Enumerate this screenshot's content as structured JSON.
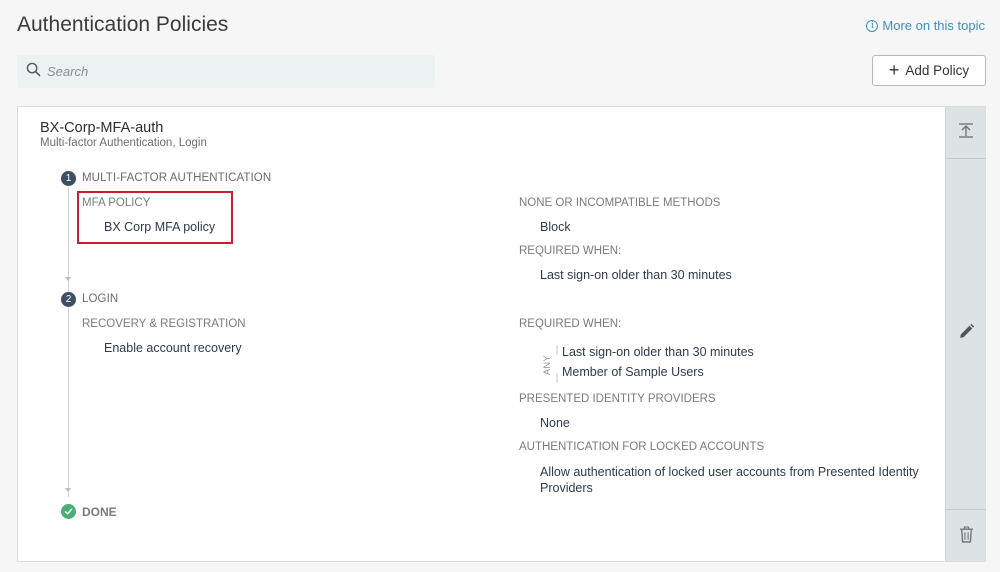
{
  "header": {
    "title": "Authentication Policies",
    "help_link": "More on this topic",
    "help_icon_glyph": "i"
  },
  "search": {
    "placeholder": "Search",
    "value": ""
  },
  "toolbar": {
    "add_label": "Add Policy",
    "add_icon_glyph": "+"
  },
  "policy": {
    "name": "BX-Corp-MFA-auth",
    "subtitle": "Multi-factor Authentication, Login",
    "steps": [
      {
        "number": "1",
        "label": "MULTI-FACTOR AUTHENTICATION",
        "left": {
          "label": "MFA POLICY",
          "value": "BX Corp MFA policy"
        },
        "right": [
          {
            "label": "NONE OR INCOMPATIBLE METHODS",
            "values": [
              "Block"
            ]
          },
          {
            "label": "REQUIRED WHEN:",
            "values": [
              "Last sign-on older than 30 minutes"
            ]
          }
        ]
      },
      {
        "number": "2",
        "label": "LOGIN",
        "left": {
          "label": "RECOVERY & REGISTRATION",
          "value": "Enable account recovery"
        },
        "right": [
          {
            "label": "REQUIRED WHEN:",
            "any_label": "ANY",
            "values": [
              "Last sign-on older than 30 minutes",
              "Member of Sample Users"
            ]
          },
          {
            "label": "PRESENTED IDENTITY PROVIDERS",
            "values": [
              "None"
            ]
          },
          {
            "label": "AUTHENTICATION FOR LOCKED ACCOUNTS",
            "values": [
              "Allow authentication of locked user accounts from Presented Identity Providers"
            ]
          }
        ]
      }
    ],
    "done_label": "DONE"
  },
  "colors": {
    "accent_link": "#3d8fc4",
    "step_badge": "#3e4f63",
    "done_badge": "#48b072",
    "highlight": "#c8202e",
    "sidebar": "#dde2e5"
  },
  "icons": {
    "search": "search-icon",
    "collapse": "collapse-to-top-icon",
    "edit": "pencil-icon",
    "delete": "trash-icon",
    "done": "check-icon",
    "info": "info-icon"
  }
}
